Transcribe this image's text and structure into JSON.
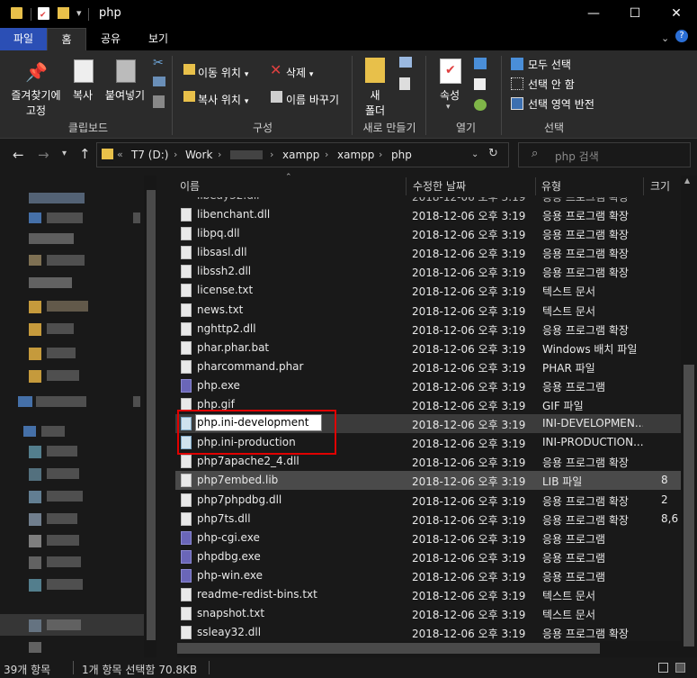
{
  "window": {
    "title": "php",
    "controls": [
      "—",
      "☐",
      "✕"
    ]
  },
  "ribbon_tabs": [
    "파일",
    "홈",
    "공유",
    "보기"
  ],
  "ribbon": {
    "clipboard": {
      "pin": "즐겨찾기에\n고정",
      "pin_l1": "즐겨찾기에",
      "pin_l2": "고정",
      "copy": "복사",
      "paste": "붙여넣기",
      "group": "클립보드"
    },
    "organize": {
      "move_to": "이동 위치",
      "copy_to": "복사 위치",
      "delete": "삭제",
      "rename": "이름 바꾸기",
      "group": "구성"
    },
    "new": {
      "new_folder_l1": "새",
      "new_folder_l2": "폴더",
      "group": "새로 만들기"
    },
    "open": {
      "properties": "속성",
      "group": "열기"
    },
    "select": {
      "select_all": "모두 선택",
      "select_none": "선택 안 함",
      "invert": "선택 영역 반전",
      "group": "선택"
    }
  },
  "address": {
    "overflow": "«",
    "crumbs": [
      "T7 (D:)",
      "Work",
      "xampp",
      "xampp",
      "php"
    ],
    "search_placeholder": "php 검색"
  },
  "columns": {
    "name": "이름",
    "modified": "수정한 날짜",
    "type": "유형",
    "size": "크기"
  },
  "files": [
    {
      "name": "libenchant.dll",
      "date": "2018-12-06 오후 3:19",
      "type": "응용 프로그램 확장",
      "size": "",
      "icon": "dll"
    },
    {
      "name": "libpq.dll",
      "date": "2018-12-06 오후 3:19",
      "type": "응용 프로그램 확장",
      "size": "",
      "icon": "dll"
    },
    {
      "name": "libsasl.dll",
      "date": "2018-12-06 오후 3:19",
      "type": "응용 프로그램 확장",
      "size": "",
      "icon": "dll"
    },
    {
      "name": "libssh2.dll",
      "date": "2018-12-06 오후 3:19",
      "type": "응용 프로그램 확장",
      "size": "",
      "icon": "dll"
    },
    {
      "name": "license.txt",
      "date": "2018-12-06 오후 3:19",
      "type": "텍스트 문서",
      "size": "",
      "icon": "txt"
    },
    {
      "name": "news.txt",
      "date": "2018-12-06 오후 3:19",
      "type": "텍스트 문서",
      "size": "",
      "icon": "txt"
    },
    {
      "name": "nghttp2.dll",
      "date": "2018-12-06 오후 3:19",
      "type": "응용 프로그램 확장",
      "size": "",
      "icon": "dll"
    },
    {
      "name": "phar.phar.bat",
      "date": "2018-12-06 오후 3:19",
      "type": "Windows 배치 파일",
      "size": "",
      "icon": "bat"
    },
    {
      "name": "pharcommand.phar",
      "date": "2018-12-06 오후 3:19",
      "type": "PHAR 파일",
      "size": "",
      "icon": "file"
    },
    {
      "name": "php.exe",
      "date": "2018-12-06 오후 3:19",
      "type": "응용 프로그램",
      "size": "",
      "icon": "exe"
    },
    {
      "name": "php.gif",
      "date": "2018-12-06 오후 3:19",
      "type": "GIF 파일",
      "size": "",
      "icon": "file"
    },
    {
      "name": "php.ini-development",
      "date": "2018-12-06 오후 3:19",
      "type": "INI-DEVELOPMEN...",
      "size": "",
      "icon": "ini"
    },
    {
      "name": "php.ini-production",
      "date": "2018-12-06 오후 3:19",
      "type": "INI-PRODUCTION...",
      "size": "",
      "icon": "ini"
    },
    {
      "name": "php7apache2_4.dll",
      "date": "2018-12-06 오후 3:19",
      "type": "응용 프로그램 확장",
      "size": "",
      "icon": "dll"
    },
    {
      "name": "php7embed.lib",
      "date": "2018-12-06 오후 3:19",
      "type": "LIB 파일",
      "size": "8",
      "icon": "file"
    },
    {
      "name": "php7phpdbg.dll",
      "date": "2018-12-06 오후 3:19",
      "type": "응용 프로그램 확장",
      "size": "2",
      "icon": "dll"
    },
    {
      "name": "php7ts.dll",
      "date": "2018-12-06 오후 3:19",
      "type": "응용 프로그램 확장",
      "size": "8,6",
      "icon": "dll"
    },
    {
      "name": "php-cgi.exe",
      "date": "2018-12-06 오후 3:19",
      "type": "응용 프로그램",
      "size": "",
      "icon": "exe"
    },
    {
      "name": "phpdbg.exe",
      "date": "2018-12-06 오후 3:19",
      "type": "응용 프로그램",
      "size": "",
      "icon": "exe"
    },
    {
      "name": "php-win.exe",
      "date": "2018-12-06 오후 3:19",
      "type": "응용 프로그램",
      "size": "",
      "icon": "exe"
    },
    {
      "name": "readme-redist-bins.txt",
      "date": "2018-12-06 오후 3:19",
      "type": "텍스트 문서",
      "size": "",
      "icon": "txt"
    },
    {
      "name": "snapshot.txt",
      "date": "2018-12-06 오후 3:19",
      "type": "텍스트 문서",
      "size": "",
      "icon": "txt"
    },
    {
      "name": "ssleay32.dll",
      "date": "2018-12-06 오후 3:19",
      "type": "응용 프로그램 확장",
      "size": "",
      "icon": "dll"
    }
  ],
  "rename_value": "php.ini-development",
  "status": {
    "count": "39개 항목",
    "selected": "1개 항목 선택함 70.8KB"
  },
  "colors": {
    "accent_file_tab": "#2b4fb5",
    "highlight_box": "#e00000"
  }
}
